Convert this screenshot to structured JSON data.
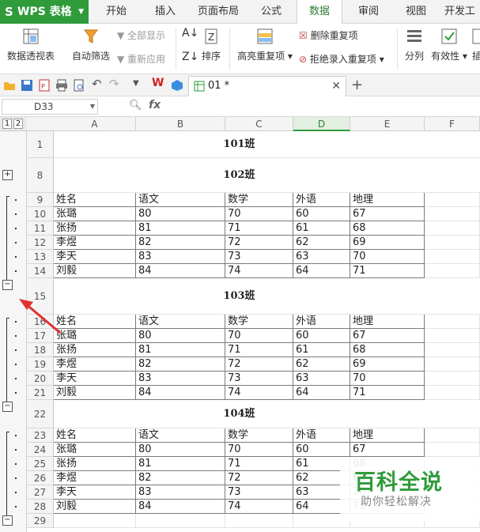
{
  "app": {
    "brand": "WPS 表格"
  },
  "menu": {
    "tabs": [
      "开始",
      "插入",
      "页面布局",
      "公式",
      "数据",
      "审阅",
      "视图",
      "开发工"
    ],
    "active": "数据"
  },
  "ribbon": {
    "pivot": "数据透视表",
    "autofilter": "自动筛选",
    "show_all": "全部显示",
    "reapply": "重新应用",
    "sort": "排序",
    "highlight_dup": "高亮重复项",
    "remove_dup": "删除重复项",
    "reject_dup": "拒绝录入重复项",
    "split": "分列",
    "validity": "有效性",
    "more": "插"
  },
  "document": {
    "tab_name": "01 *"
  },
  "formula_bar": {
    "name_box": "D33",
    "fx": "fx",
    "value": ""
  },
  "columns": [
    "A",
    "B",
    "C",
    "D",
    "E",
    "F"
  ],
  "selected_column": "D",
  "outline_levels": [
    "1",
    "2"
  ],
  "headers": [
    "姓名",
    "语文",
    "数学",
    "外语",
    "地理"
  ],
  "groups": [
    {
      "title_row": "1",
      "title": "101班"
    },
    {
      "title_row": "8",
      "title": "102班",
      "header_row": "9",
      "rows": [
        {
          "n": "10",
          "c": [
            "张璐",
            "80",
            "70",
            "60",
            "67"
          ]
        },
        {
          "n": "11",
          "c": [
            "张扬",
            "81",
            "71",
            "61",
            "68"
          ]
        },
        {
          "n": "12",
          "c": [
            "李煜",
            "82",
            "72",
            "62",
            "69"
          ]
        },
        {
          "n": "13",
          "c": [
            "李天",
            "83",
            "73",
            "63",
            "70"
          ]
        },
        {
          "n": "14",
          "c": [
            "刘毅",
            "84",
            "74",
            "64",
            "71"
          ]
        }
      ]
    },
    {
      "title_row": "15",
      "title": "103班",
      "header_row": "16",
      "rows": [
        {
          "n": "17",
          "c": [
            "张璐",
            "80",
            "70",
            "60",
            "67"
          ]
        },
        {
          "n": "18",
          "c": [
            "张扬",
            "81",
            "71",
            "61",
            "68"
          ]
        },
        {
          "n": "19",
          "c": [
            "李煜",
            "82",
            "72",
            "62",
            "69"
          ]
        },
        {
          "n": "20",
          "c": [
            "李天",
            "83",
            "73",
            "63",
            "70"
          ]
        },
        {
          "n": "21",
          "c": [
            "刘毅",
            "84",
            "74",
            "64",
            "71"
          ]
        }
      ]
    },
    {
      "title_row": "22",
      "title": "104班",
      "header_row": "23",
      "rows": [
        {
          "n": "24",
          "c": [
            "张璐",
            "80",
            "70",
            "60",
            "67"
          ]
        },
        {
          "n": "25",
          "c": [
            "张扬",
            "81",
            "71",
            "61",
            "68"
          ]
        },
        {
          "n": "26",
          "c": [
            "李煜",
            "82",
            "72",
            "62",
            "69"
          ]
        },
        {
          "n": "27",
          "c": [
            "李天",
            "83",
            "73",
            "63",
            "70"
          ]
        },
        {
          "n": "28",
          "c": [
            "刘毅",
            "84",
            "74",
            "64",
            "71"
          ]
        }
      ]
    }
  ],
  "last_row": "29",
  "watermark": {
    "title": "百科全说",
    "subtitle": "助你轻松解决"
  },
  "colors": {
    "brand": "#2f9b3b",
    "arrow": "#e03030"
  }
}
